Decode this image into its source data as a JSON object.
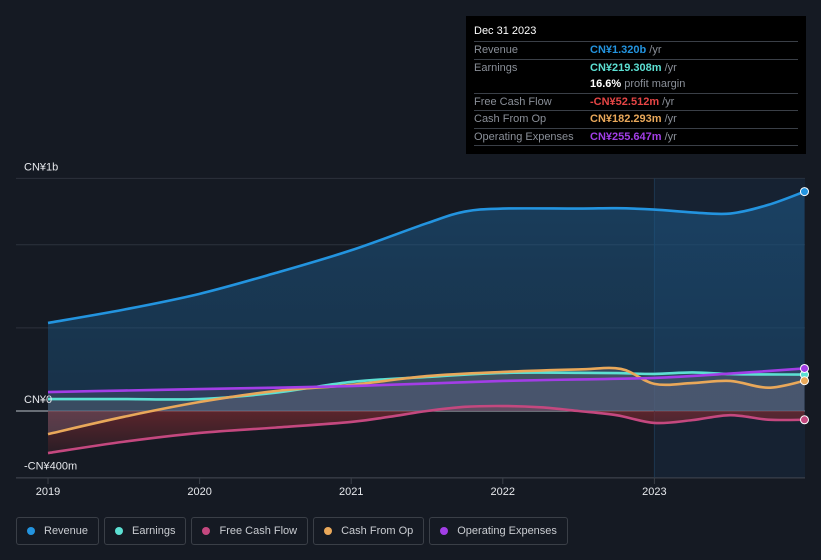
{
  "chart_data": {
    "type": "area",
    "title": "",
    "xlabel": "",
    "ylabel": "",
    "x_range": [
      2019.0,
      2024.0
    ],
    "ylim": [
      -400,
      1400
    ],
    "y_unit": "CN¥ millions",
    "x_ticks": [
      2019,
      2020,
      2021,
      2022,
      2023
    ],
    "x_tick_labels": [
      "2019",
      "2020",
      "2021",
      "2022",
      "2023"
    ],
    "y_tick_labels": [
      {
        "value": 1400,
        "label": "CN¥1b"
      },
      {
        "value": 0,
        "label": "CN¥0"
      },
      {
        "value": -400,
        "label": "-CN¥400m"
      }
    ],
    "gridlines_y": [
      1400,
      1000,
      500,
      0,
      -400
    ],
    "highlight_from": 2023.0,
    "legend_position": "bottom-left",
    "series": [
      {
        "name": "Revenue",
        "color": "#2394df",
        "x": [
          2019.0,
          2019.5,
          2020.0,
          2020.5,
          2021.0,
          2021.5,
          2021.75,
          2022.0,
          2022.5,
          2022.75,
          2023.0,
          2023.25,
          2023.5,
          2023.75,
          2023.99
        ],
        "y": [
          530,
          610,
          705,
          830,
          967,
          1130,
          1200,
          1218,
          1218,
          1220,
          1212,
          1195,
          1188,
          1240,
          1320
        ]
      },
      {
        "name": "Earnings",
        "color": "#5ce0d3",
        "x": [
          2019.0,
          2019.5,
          2020.0,
          2020.5,
          2021.0,
          2021.5,
          2022.0,
          2022.5,
          2022.75,
          2023.0,
          2023.25,
          2023.5,
          2023.75,
          2023.99
        ],
        "y": [
          72,
          72,
          72,
          110,
          175,
          205,
          229,
          230,
          228,
          223,
          232,
          222,
          220,
          219
        ]
      },
      {
        "name": "Free Cash Flow",
        "color": "#c4487f",
        "x": [
          2019.0,
          2019.5,
          2020.0,
          2020.5,
          2021.0,
          2021.25,
          2021.5,
          2021.75,
          2022.0,
          2022.25,
          2022.5,
          2022.75,
          2023.0,
          2023.25,
          2023.5,
          2023.75,
          2023.99
        ],
        "y": [
          -253,
          -185,
          -132,
          -100,
          -66,
          -35,
          0,
          25,
          30,
          22,
          0,
          -25,
          -72,
          -55,
          -25,
          -52,
          -53
        ]
      },
      {
        "name": "Cash From Op",
        "color": "#e9a85a",
        "x": [
          2019.0,
          2019.5,
          2020.0,
          2020.5,
          2021.0,
          2021.5,
          2022.0,
          2022.5,
          2022.78,
          2023.0,
          2023.25,
          2023.5,
          2023.75,
          2023.99
        ],
        "y": [
          -139,
          -35,
          54,
          120,
          157,
          210,
          235,
          250,
          253,
          163,
          168,
          181,
          140,
          182
        ]
      },
      {
        "name": "Operating Expenses",
        "color": "#a23ee6",
        "x": [
          2019.0,
          2019.5,
          2020.0,
          2020.5,
          2021.0,
          2021.5,
          2022.0,
          2022.5,
          2023.0,
          2023.5,
          2023.99
        ],
        "y": [
          114,
          123,
          132,
          140,
          150,
          165,
          181,
          190,
          199,
          225,
          256
        ]
      }
    ]
  },
  "tooltip": {
    "date": "Dec 31 2023",
    "rows": [
      {
        "label": "Revenue",
        "value": "CN¥1.320b",
        "unit": "/yr",
        "color": "#2394df"
      },
      {
        "label": "Earnings",
        "value": "CN¥219.308m",
        "unit": "/yr",
        "color": "#5ce0d3"
      },
      {
        "label": "",
        "value": "16.6%",
        "unit": "profit margin",
        "color": "#ffffff"
      },
      {
        "label": "Free Cash Flow",
        "value": "-CN¥52.512m",
        "unit": "/yr",
        "color": "#e64545"
      },
      {
        "label": "Cash From Op",
        "value": "CN¥182.293m",
        "unit": "/yr",
        "color": "#e9a85a"
      },
      {
        "label": "Operating Expenses",
        "value": "CN¥255.647m",
        "unit": "/yr",
        "color": "#a23ee6"
      }
    ]
  },
  "legend": [
    {
      "label": "Revenue",
      "color": "#2394df"
    },
    {
      "label": "Earnings",
      "color": "#5ce0d3"
    },
    {
      "label": "Free Cash Flow",
      "color": "#c4487f"
    },
    {
      "label": "Cash From Op",
      "color": "#e9a85a"
    },
    {
      "label": "Operating Expenses",
      "color": "#a23ee6"
    }
  ]
}
